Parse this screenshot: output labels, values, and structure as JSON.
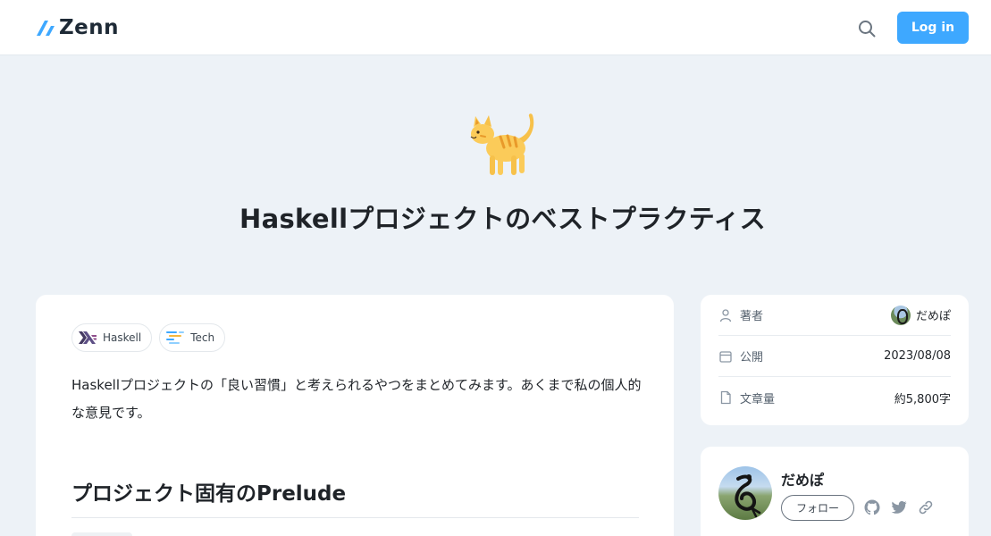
{
  "header": {
    "logo_text": "Zenn",
    "search_icon": "search-icon",
    "login_label": "Log in",
    "accent_color": "#3ea8ff"
  },
  "article": {
    "emoji": "cat-emoji",
    "title": "Haskellプロジェクトのベストプラクティス",
    "topics": [
      {
        "label": "Haskell",
        "icon": "haskell-icon"
      },
      {
        "label": "Tech",
        "icon": "tech-icon"
      }
    ],
    "lead": "Haskellプロジェクトの「良い習慣」と考えられるやつをまとめてみます。あくまで私の個人的な意見です。",
    "heading": "プロジェクト固有のPrelude"
  },
  "info": {
    "author_label": "著者",
    "author_name": "だめぽ",
    "published_label": "公開",
    "published_date": "2023/08/08",
    "wordcount_label": "文章量",
    "wordcount_value": "約5,800字"
  },
  "author_card": {
    "name": "だめぽ",
    "follow_label": "フォロー",
    "social_icons": [
      "github-icon",
      "twitter-icon",
      "link-icon"
    ]
  }
}
